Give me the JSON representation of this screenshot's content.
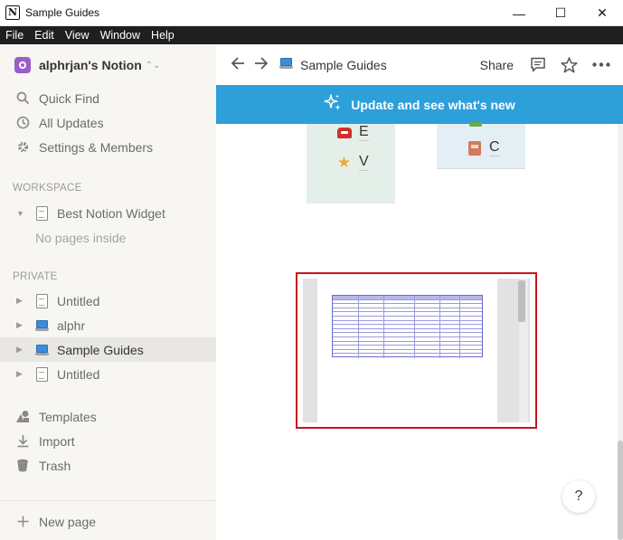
{
  "window": {
    "title": "Sample Guides",
    "controls": {
      "minimize": "—",
      "maximize": "☐",
      "close": "✕"
    }
  },
  "menubar": {
    "items": [
      "File",
      "Edit",
      "View",
      "Window",
      "Help"
    ]
  },
  "sidebar": {
    "workspace_name": "alphrjan's Notion",
    "actions": [
      {
        "label": "Quick Find",
        "icon": "search-icon"
      },
      {
        "label": "All Updates",
        "icon": "clock-icon"
      },
      {
        "label": "Settings & Members",
        "icon": "gear-icon"
      }
    ],
    "workspace_section": {
      "label": "WORKSPACE",
      "pages": [
        {
          "label": "Best Notion Widget",
          "icon": "document-icon"
        }
      ],
      "empty_text": "No pages inside"
    },
    "private_section": {
      "label": "PRIVATE",
      "pages": [
        {
          "label": "Untitled",
          "icon": "document-icon"
        },
        {
          "label": "alphr",
          "icon": "laptop-icon"
        },
        {
          "label": "Sample Guides",
          "icon": "laptop-icon",
          "active": true
        },
        {
          "label": "Untitled",
          "icon": "document-icon"
        }
      ]
    },
    "tools": [
      {
        "label": "Templates",
        "icon": "shapes-icon"
      },
      {
        "label": "Import",
        "icon": "download-icon"
      },
      {
        "label": "Trash",
        "icon": "trash-icon"
      }
    ],
    "new_page": "New page"
  },
  "topbar": {
    "breadcrumb": "Sample Guides",
    "share": "Share"
  },
  "banner": {
    "text": "Update and see what's new"
  },
  "cards": {
    "green": [
      {
        "label": "E",
        "icon": "telephone-icon"
      },
      {
        "label": "V",
        "icon": "star-icon"
      }
    ],
    "blue": [
      {
        "label": "C",
        "icon": "book-icon"
      }
    ]
  },
  "help": {
    "label": "?"
  },
  "colors": {
    "banner": "#2d9fd9",
    "highlight": "#c4161c",
    "sidebar_bg": "#f7f6f3",
    "workspace_avatar": "#9b5ec9"
  }
}
